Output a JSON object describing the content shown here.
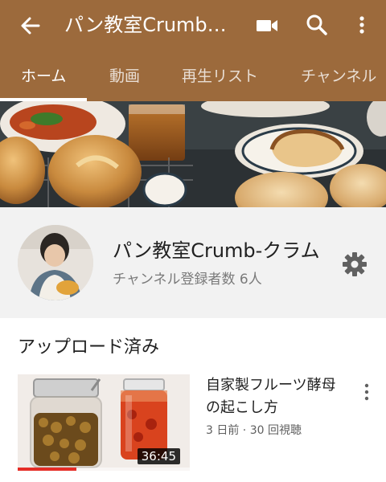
{
  "colors": {
    "brand": "#9c6a3c",
    "progress": "#e52d27"
  },
  "icons": {
    "back": "arrow-left",
    "camera": "video-camera",
    "search": "magnifier",
    "more": "vertical-ellipsis",
    "settings": "gear"
  },
  "appbar": {
    "title": "パン教室Crumb-クラム"
  },
  "tabs": [
    {
      "label": "ホーム",
      "active": true
    },
    {
      "label": "動画",
      "active": false
    },
    {
      "label": "再生リスト",
      "active": false
    },
    {
      "label": "チャンネル",
      "active": false
    }
  ],
  "channel": {
    "name": "パン教室Crumb-クラム",
    "subscribers": "チャンネル登録者数 6人"
  },
  "uploads": {
    "title": "アップロード済み",
    "videos": [
      {
        "title": "自家製フルーツ酵母の起こし方",
        "meta": "3 日前 · 30 回視聴",
        "duration": "36:45",
        "watched_fraction": 0.34
      }
    ]
  }
}
